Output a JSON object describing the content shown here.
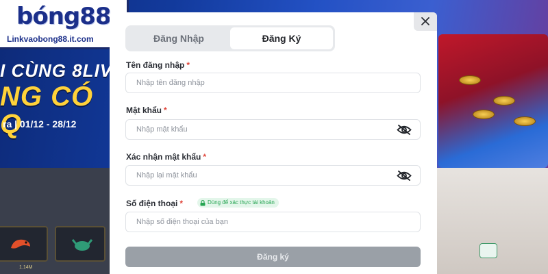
{
  "logo": {
    "brand": "bóng88",
    "url": "Linkvaobong88.it.com"
  },
  "background": {
    "banner_line1": "I CÙNG 8LIV",
    "banner_line2": "NG CÓ Q",
    "banner_date": "ra | 01/12 - 28/12",
    "tile_amount": "1.14M"
  },
  "modal": {
    "close_icon": "close-icon",
    "tabs": {
      "login": "Đăng Nhập",
      "register": "Đăng Ký",
      "active": "register"
    },
    "fields": {
      "username": {
        "label": "Tên đăng nhập",
        "required": "*",
        "placeholder": "Nhập tên đăng nhập",
        "value": ""
      },
      "password": {
        "label": "Mật khẩu",
        "required": "*",
        "placeholder": "Nhập mật khẩu",
        "value": "",
        "icon": "eye-off-icon"
      },
      "confirm_password": {
        "label": "Xác nhận mật khẩu",
        "required": "*",
        "placeholder": "Nhập lại mật khẩu",
        "value": "",
        "icon": "eye-off-icon"
      },
      "phone": {
        "label": "Số điện thoại",
        "required": "*",
        "placeholder": "Nhập số điện thoại của bạn",
        "value": "",
        "badge": "Dùng để xác thực tài khoản",
        "badge_icon": "lock-icon"
      }
    },
    "submit_label": "Đăng ký"
  },
  "colors": {
    "brand_blue": "#1b2f8a",
    "required_red": "#e0453a",
    "badge_green": "#27a553",
    "submit_disabled": "#9aa0a7"
  }
}
